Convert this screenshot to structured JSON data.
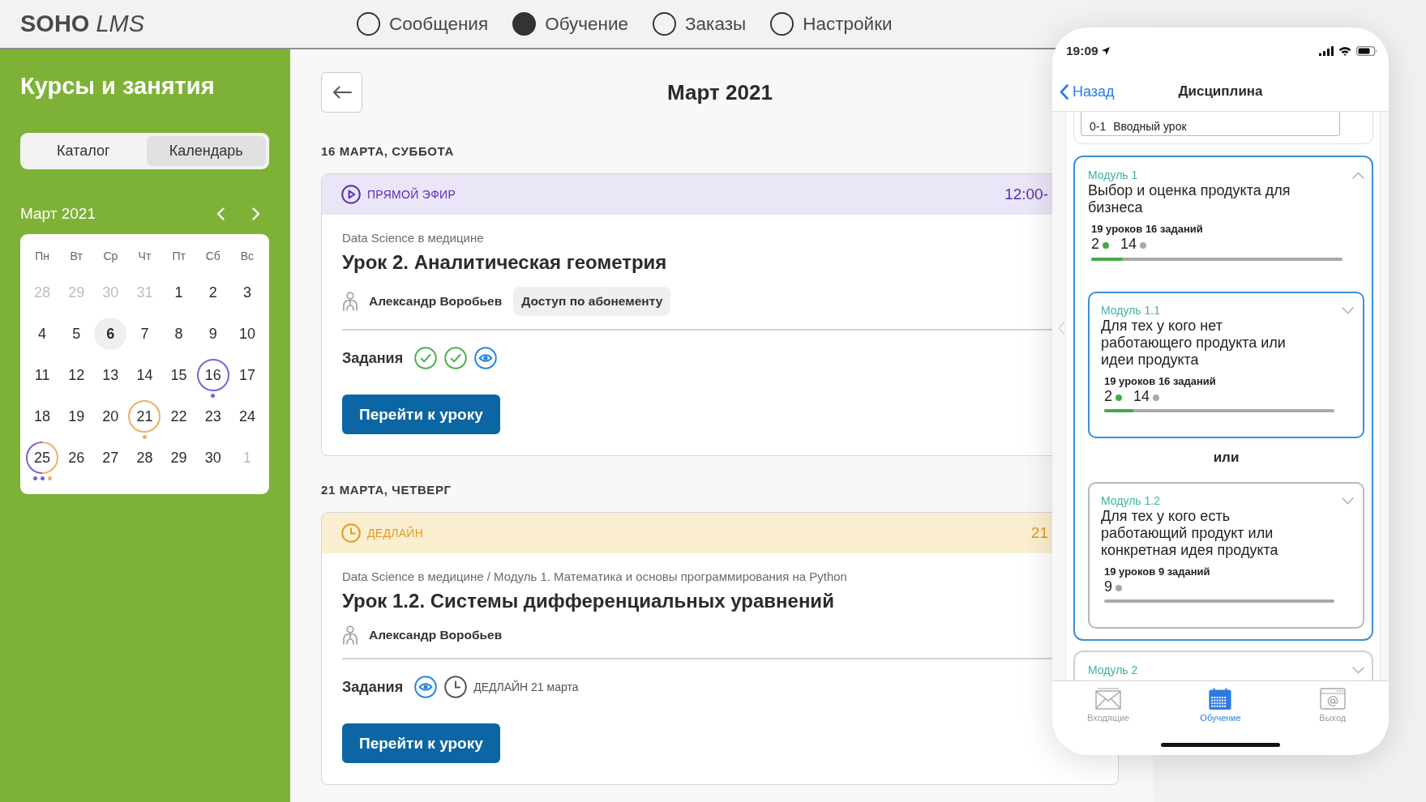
{
  "topbar": {
    "logo": {
      "brand": "SOHO",
      "product": "LMS"
    },
    "nav": [
      {
        "label": "Сообщения",
        "selected": false
      },
      {
        "label": "Обучение",
        "selected": true
      },
      {
        "label": "Заказы",
        "selected": false
      },
      {
        "label": "Настройки",
        "selected": false
      }
    ]
  },
  "sidebar": {
    "title": "Курсы и занятия",
    "view_tabs": [
      {
        "label": "Каталог",
        "selected": false
      },
      {
        "label": "Календарь",
        "selected": true
      }
    ],
    "calendar": {
      "month": "Март 2021",
      "weekdays": [
        "Пн",
        "Вт",
        "Ср",
        "Чт",
        "Пт",
        "Сб",
        "Вс"
      ],
      "weeks": [
        [
          {
            "day": "28",
            "muted": true,
            "selected": false
          },
          {
            "day": "29",
            "muted": true,
            "selected": false
          },
          {
            "day": "30",
            "muted": true,
            "selected": false
          },
          {
            "day": "31",
            "muted": true,
            "selected": false
          },
          {
            "day": "1",
            "muted": false,
            "selected": false
          },
          {
            "day": "2",
            "muted": false,
            "selected": false
          },
          {
            "day": "3",
            "muted": false,
            "selected": false
          }
        ],
        [
          {
            "day": "4",
            "muted": false,
            "selected": false
          },
          {
            "day": "5",
            "muted": false,
            "selected": false
          },
          {
            "day": "6",
            "muted": false,
            "selected": true
          },
          {
            "day": "7",
            "muted": false,
            "selected": false
          },
          {
            "day": "8",
            "muted": false,
            "selected": false
          },
          {
            "day": "9",
            "muted": false,
            "selected": false
          },
          {
            "day": "10",
            "muted": false,
            "selected": false
          }
        ],
        [
          {
            "day": "11",
            "muted": false,
            "selected": false
          },
          {
            "day": "12",
            "muted": false,
            "selected": false
          },
          {
            "day": "13",
            "muted": false,
            "selected": false
          },
          {
            "day": "14",
            "muted": false,
            "selected": false
          },
          {
            "day": "15",
            "muted": false,
            "selected": false
          },
          {
            "day": "16",
            "muted": false,
            "selected": false,
            "events": [
              {
                "color": "#7b60d8"
              }
            ]
          },
          {
            "day": "17",
            "muted": false,
            "selected": false
          }
        ],
        [
          {
            "day": "18",
            "muted": false,
            "selected": false
          },
          {
            "day": "19",
            "muted": false,
            "selected": false
          },
          {
            "day": "20",
            "muted": false,
            "selected": false
          },
          {
            "day": "21",
            "muted": false,
            "selected": false,
            "events": [
              {
                "color": "#efb062"
              }
            ]
          },
          {
            "day": "22",
            "muted": false,
            "selected": false
          },
          {
            "day": "23",
            "muted": false,
            "selected": false
          },
          {
            "day": "24",
            "muted": false,
            "selected": false
          }
        ],
        [
          {
            "day": "25",
            "muted": false,
            "selected": false,
            "events": [
              {
                "color": "#7b60d8"
              },
              {
                "color": "#7b60d8"
              },
              {
                "color": "#efb062"
              }
            ]
          },
          {
            "day": "26",
            "muted": false,
            "selected": false
          },
          {
            "day": "27",
            "muted": false,
            "selected": false
          },
          {
            "day": "28",
            "muted": false,
            "selected": false
          },
          {
            "day": "29",
            "muted": false,
            "selected": false
          },
          {
            "day": "30",
            "muted": false,
            "selected": false
          },
          {
            "day": "1",
            "muted": true,
            "selected": false
          }
        ]
      ]
    }
  },
  "main": {
    "title": "Март 2021",
    "days": [
      {
        "heading": "16 МАРТА, СУББОТА",
        "events": [
          {
            "kind": "live",
            "badge": "ПРЯМОЙ ЭФИР",
            "time": "12:00-",
            "course": "Data Science в медицине",
            "title": "Урок 2. Аналитическая геометрия",
            "teacher": "Александр Воробьев",
            "access": "Доступ по абонементу",
            "tasks_label": "Задания",
            "tasks": [
              {
                "kind": "done"
              },
              {
                "kind": "done"
              },
              {
                "kind": "viewed"
              }
            ],
            "button": "Перейти к уроку"
          }
        ]
      },
      {
        "heading": "21 МАРТА, ЧЕТВЕРГ",
        "events": [
          {
            "kind": "deadline",
            "badge": "ДЕДЛАЙН",
            "time": "21",
            "course": "Data Science в медицине / Модуль 1. Математика и основы программирования на Python",
            "title": "Урок 1.2. Системы дифференциальных уравнений",
            "teacher": "Александр Воробьев",
            "tasks_label": "Задания",
            "tasks": [
              {
                "kind": "viewed"
              },
              {
                "kind": "deadline",
                "label": "ДЕДЛАЙН 21 марта"
              }
            ],
            "button": "Перейти к уроку"
          }
        ]
      }
    ]
  },
  "phone": {
    "status_bar": {
      "time": "19:09"
    },
    "nav_bar": {
      "back": "Назад",
      "title": "Дисциплина"
    },
    "intro_lesson": {
      "number": "0-1",
      "title": "Вводный урок"
    },
    "modules": [
      {
        "label": "Модуль 1",
        "title": "Выбор и оценка продукта для бизнеса",
        "active": true,
        "expanded": true,
        "stats": "19 уроков 16 заданий",
        "counts": [
          {
            "kind": "done",
            "value": "2"
          },
          {
            "kind": "pending",
            "value": "14"
          }
        ],
        "level": 0.125,
        "separator": "или",
        "children": [
          {
            "label": "Модуль 1.1",
            "title": "Для тех у кого нет работающего продукта или идеи продукта",
            "active": true,
            "expanded": false,
            "stats": "19 уроков 16 заданий",
            "counts": [
              {
                "kind": "done",
                "value": "2"
              },
              {
                "kind": "pending",
                "value": "14"
              }
            ],
            "level": 0.125
          },
          {
            "label": "Модуль 1.2",
            "title": "Для тех у кого есть работающий продукт или конкретная идея продукта",
            "active": false,
            "expanded": false,
            "stats": "19 уроков 9 заданий",
            "counts": [
              {
                "kind": "pending",
                "value": "9"
              }
            ]
          }
        ]
      },
      {
        "label": "Модуль 2",
        "active": false,
        "expanded": false
      }
    ],
    "tab_bar": [
      {
        "label": "Входящие",
        "selected": false
      },
      {
        "label": "Обучение",
        "selected": true
      },
      {
        "label": "Выход",
        "selected": false
      }
    ]
  }
}
